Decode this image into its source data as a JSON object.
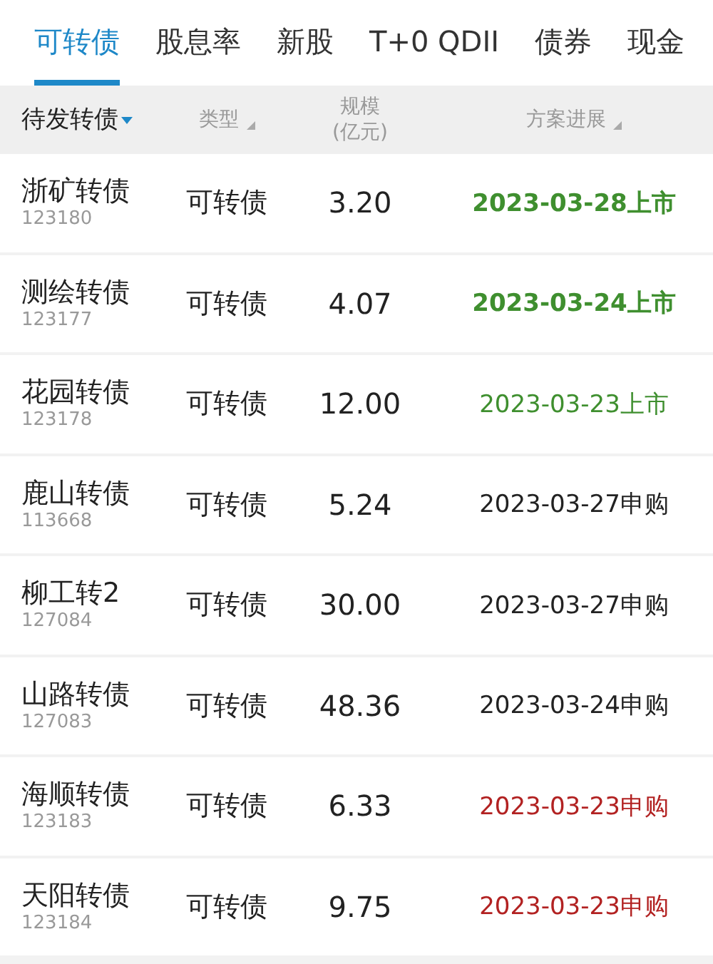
{
  "tabs": [
    {
      "label": "可转债",
      "selected": true
    },
    {
      "label": "股息率",
      "selected": false
    },
    {
      "label": "新股",
      "selected": false
    },
    {
      "label": "T+0 QDII",
      "selected": false
    },
    {
      "label": "债券",
      "selected": false
    },
    {
      "label": "现金",
      "selected": false
    }
  ],
  "table": {
    "columns": [
      {
        "label": "待发转债",
        "kind": "dropdown"
      },
      {
        "label": "类型",
        "kind": "sortable"
      },
      {
        "label": "规模\n(亿元)",
        "kind": "plain"
      },
      {
        "label": "方案进展",
        "kind": "sortable"
      }
    ],
    "rows": [
      {
        "name": "浙矿转债",
        "code": "123180",
        "type": "可转债",
        "scale": "3.20",
        "progress": "2023-03-28上市",
        "color": "#3f8f2f",
        "bold": true
      },
      {
        "name": "测绘转债",
        "code": "123177",
        "type": "可转债",
        "scale": "4.07",
        "progress": "2023-03-24上市",
        "color": "#3f8f2f",
        "bold": true
      },
      {
        "name": "花园转债",
        "code": "123178",
        "type": "可转债",
        "scale": "12.00",
        "progress": "2023-03-23上市",
        "color": "#3f8f2f",
        "bold": false
      },
      {
        "name": "鹿山转债",
        "code": "113668",
        "type": "可转债",
        "scale": "5.24",
        "progress": "2023-03-27申购",
        "color": "#222222",
        "bold": false
      },
      {
        "name": "柳工转2",
        "code": "127084",
        "type": "可转债",
        "scale": "30.00",
        "progress": "2023-03-27申购",
        "color": "#222222",
        "bold": false
      },
      {
        "name": "山路转债",
        "code": "127083",
        "type": "可转债",
        "scale": "48.36",
        "progress": "2023-03-24申购",
        "color": "#222222",
        "bold": false
      },
      {
        "name": "海顺转债",
        "code": "123183",
        "type": "可转债",
        "scale": "6.33",
        "progress": "2023-03-23申购",
        "color": "#b22222",
        "bold": false
      },
      {
        "name": "天阳转债",
        "code": "123184",
        "type": "可转债",
        "scale": "9.75",
        "progress": "2023-03-23申购",
        "color": "#b22222",
        "bold": false
      }
    ]
  }
}
